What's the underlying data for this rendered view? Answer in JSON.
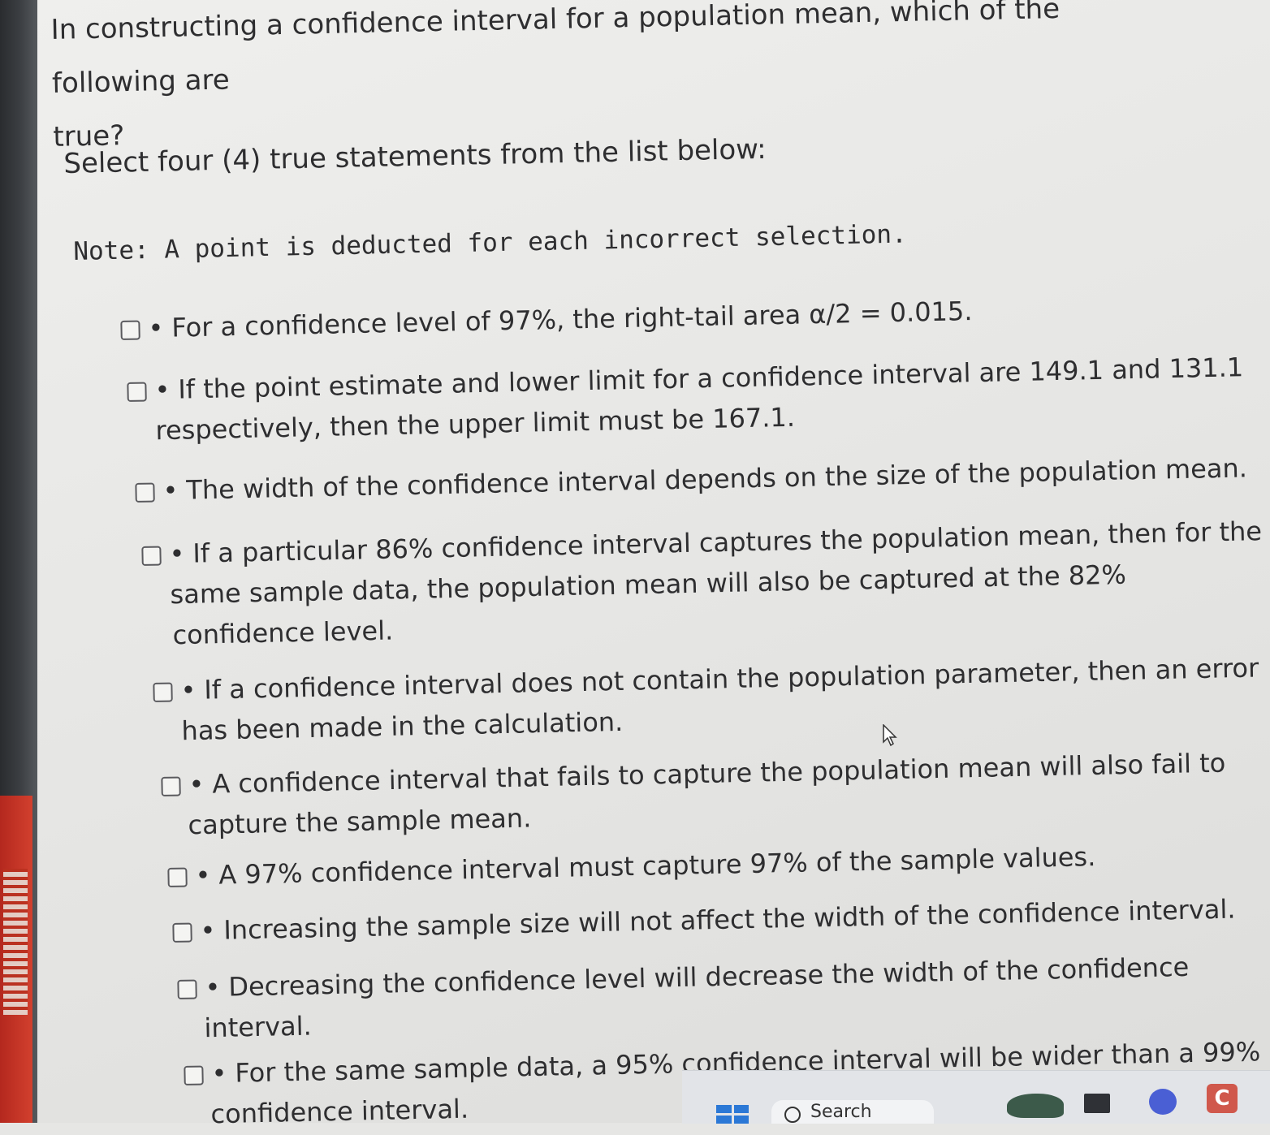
{
  "question": {
    "line1": "In constructing a confidence interval for a population mean, which of the following are",
    "line2": "true?"
  },
  "instruction": "Select four (4) true statements from the list below:",
  "note": "Note: A point is deducted for each incorrect selection.",
  "options": [
    {
      "lines": [
        "For a confidence level of 97%, the right-tail area α/2 = 0.015."
      ]
    },
    {
      "lines": [
        "If the point estimate and lower limit for a confidence interval are 149.1 and 131.1",
        "respectively, then the upper limit must be 167.1."
      ]
    },
    {
      "lines": [
        "The width of the confidence interval depends on the size of the population mean."
      ]
    },
    {
      "lines": [
        "If a particular 86% confidence interval captures the population mean, then for the",
        "same sample data, the population mean will also be captured at the 82%",
        "confidence level."
      ]
    },
    {
      "lines": [
        "If a confidence interval does not contain the population parameter, then an error",
        "has been made in the calculation."
      ]
    },
    {
      "lines": [
        "A confidence interval that fails to capture the population mean will also fail to",
        "capture the sample mean."
      ]
    },
    {
      "lines": [
        "A 97% confidence interval must capture 97% of the sample values."
      ]
    },
    {
      "lines": [
        "Increasing the sample size will not affect the width of the confidence interval."
      ]
    },
    {
      "lines": [
        "Decreasing the confidence level will decrease the width of the confidence",
        "interval."
      ]
    },
    {
      "lines": [
        "For the same sample data, a 95% confidence interval will be wider than a 99%",
        "confidence interval."
      ]
    }
  ],
  "bullet": "•",
  "taskbar": {
    "search_label": "Search",
    "app_letter": "C",
    "icons": [
      "windows-start-icon",
      "search-icon",
      "weather-icon",
      "file-explorer-icon",
      "meet-icon",
      "app-c-icon"
    ]
  }
}
